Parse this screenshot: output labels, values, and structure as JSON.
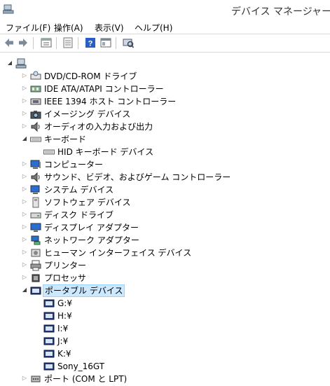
{
  "window": {
    "title": "デバイス マネージャー"
  },
  "menu": [
    "ファイル(F)",
    "操作(A)",
    "表示(V)",
    "ヘルプ(H)"
  ],
  "toolbar": [
    "back-icon",
    "forward-icon",
    "properties-icon",
    "update-icon",
    "help-icon",
    "view-icon",
    "scan-icon"
  ],
  "tree": [
    {
      "label": "",
      "depth": 0,
      "expander": "expanded",
      "icon": "computer-root-icon"
    },
    {
      "label": "DVD/CD-ROM ドライブ",
      "depth": 1,
      "expander": "collapsed",
      "icon": "dvd-drive-icon"
    },
    {
      "label": "IDE ATA/ATAPI コントローラー",
      "depth": 1,
      "expander": "collapsed",
      "icon": "ide-controller-icon"
    },
    {
      "label": "IEEE 1394 ホスト コントローラー",
      "depth": 1,
      "expander": "collapsed",
      "icon": "ieee1394-icon"
    },
    {
      "label": "イメージング デバイス",
      "depth": 1,
      "expander": "collapsed",
      "icon": "camera-icon"
    },
    {
      "label": "オーディオの入力および出力",
      "depth": 1,
      "expander": "collapsed",
      "icon": "speaker-icon"
    },
    {
      "label": "キーボード",
      "depth": 1,
      "expander": "expanded",
      "icon": "keyboard-icon"
    },
    {
      "label": "HID キーボード デバイス",
      "depth": 2,
      "expander": "none",
      "icon": "keyboard-icon"
    },
    {
      "label": "コンピューター",
      "depth": 1,
      "expander": "collapsed",
      "icon": "computer-icon"
    },
    {
      "label": "サウンド、ビデオ、およびゲーム コントローラー",
      "depth": 1,
      "expander": "collapsed",
      "icon": "speaker-icon"
    },
    {
      "label": "システム デバイス",
      "depth": 1,
      "expander": "collapsed",
      "icon": "system-icon"
    },
    {
      "label": "ソフトウェア デバイス",
      "depth": 1,
      "expander": "collapsed",
      "icon": "software-icon"
    },
    {
      "label": "ディスク ドライブ",
      "depth": 1,
      "expander": "collapsed",
      "icon": "disk-drive-icon"
    },
    {
      "label": "ディスプレイ アダプター",
      "depth": 1,
      "expander": "collapsed",
      "icon": "display-icon"
    },
    {
      "label": "ネットワーク アダプター",
      "depth": 1,
      "expander": "collapsed",
      "icon": "network-icon"
    },
    {
      "label": "ヒューマン インターフェイス デバイス",
      "depth": 1,
      "expander": "collapsed",
      "icon": "hid-icon"
    },
    {
      "label": "プリンター",
      "depth": 1,
      "expander": "collapsed",
      "icon": "printer-icon"
    },
    {
      "label": "プロセッサ",
      "depth": 1,
      "expander": "collapsed",
      "icon": "processor-icon"
    },
    {
      "label": "ポータブル デバイス",
      "depth": 1,
      "expander": "expanded",
      "icon": "portable-device-icon",
      "selected": true
    },
    {
      "label": "G:¥",
      "depth": 2,
      "expander": "none",
      "icon": "portable-device-icon"
    },
    {
      "label": "H:¥",
      "depth": 2,
      "expander": "none",
      "icon": "portable-device-icon"
    },
    {
      "label": "I:¥",
      "depth": 2,
      "expander": "none",
      "icon": "portable-device-icon"
    },
    {
      "label": "J:¥",
      "depth": 2,
      "expander": "none",
      "icon": "portable-device-icon"
    },
    {
      "label": "K:¥",
      "depth": 2,
      "expander": "none",
      "icon": "portable-device-icon"
    },
    {
      "label": "Sony_16GT",
      "depth": 2,
      "expander": "none",
      "icon": "portable-device-icon"
    },
    {
      "label": "ポート (COM と LPT)",
      "depth": 1,
      "expander": "collapsed",
      "icon": "port-icon"
    }
  ]
}
